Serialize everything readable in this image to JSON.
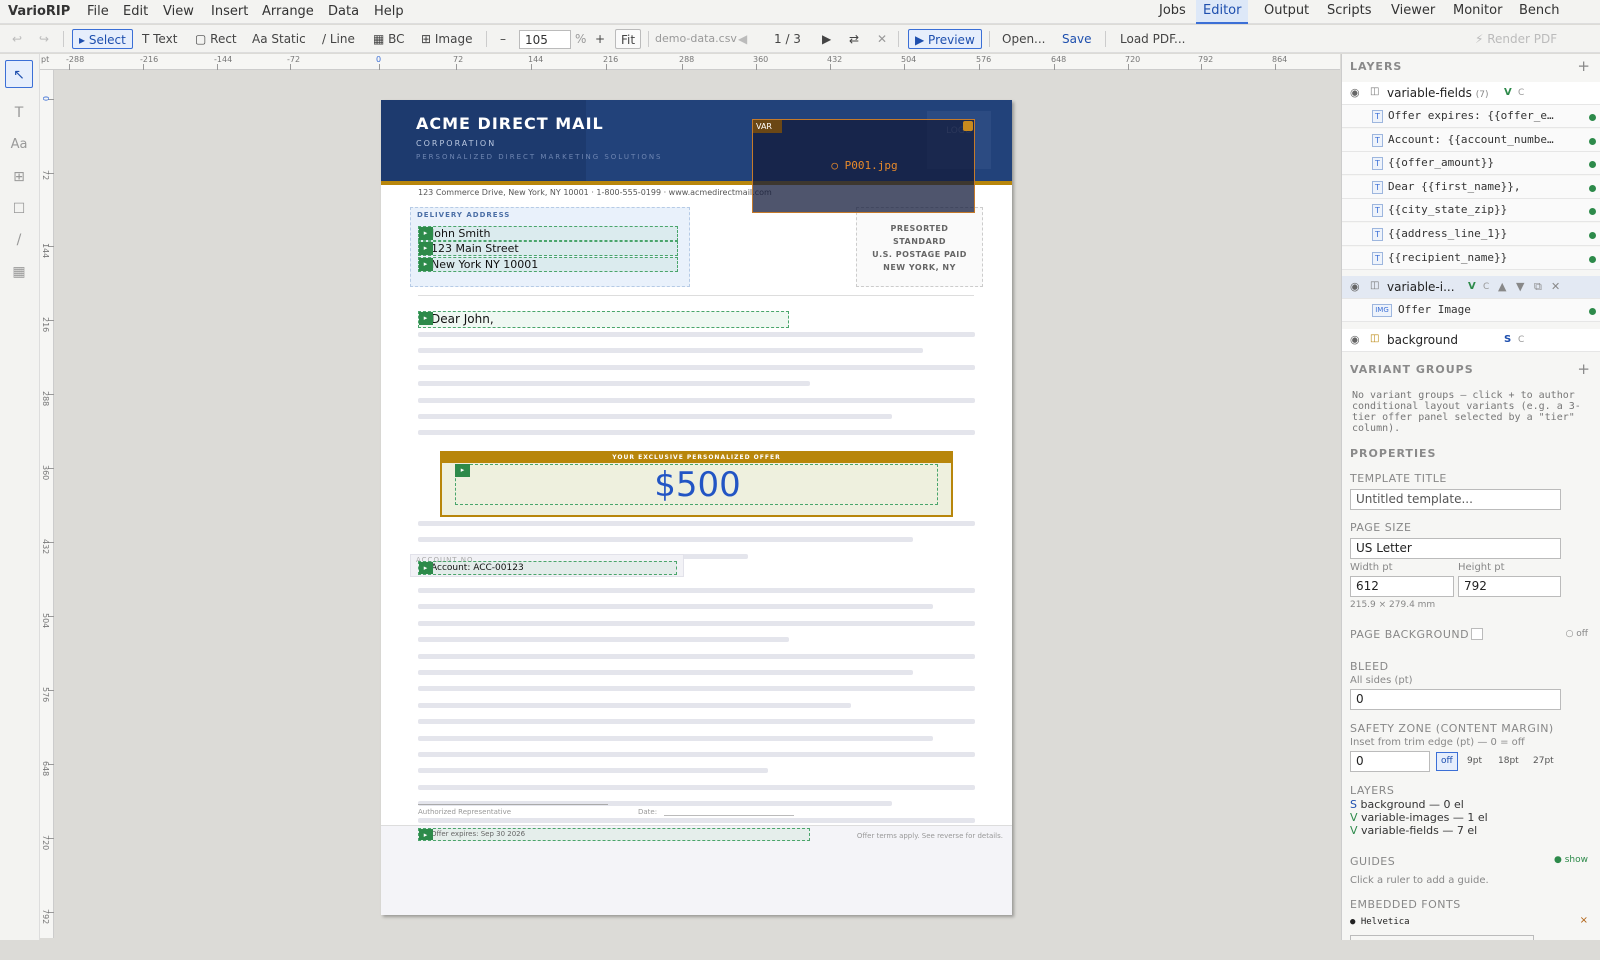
{
  "app": {
    "name": "VarioRIP",
    "menu": [
      "File",
      "Edit",
      "View",
      "Insert",
      "Arrange",
      "Data",
      "Help"
    ],
    "tabs": [
      "Jobs",
      "Editor",
      "Output",
      "Scripts",
      "Viewer",
      "Monitor",
      "Bench"
    ],
    "active_tab": "Editor"
  },
  "toolbar": {
    "undo": "↩",
    "redo": "↪",
    "select": "▸ Select",
    "text": "T Text",
    "rect": "▢ Rect",
    "static": "Aa Static",
    "line": "/ Line",
    "bc": "▦ BC",
    "image": "⊞ Image",
    "zoom_minus": "–",
    "zoom_value": "105",
    "zoom_unit": "%",
    "zoom_plus": "+",
    "fit": "Fit",
    "data_file": "demo-data.csv",
    "prev": "◀",
    "record": "1 / 3",
    "next": "▶",
    "shuffle": "⇄",
    "close": "✕",
    "preview": "▶ Preview",
    "open": "Open...",
    "save": "Save",
    "load_pdf": "Load PDF...",
    "render_pdf": "⚡ Render PDF"
  },
  "ruler": {
    "unit": "pt",
    "h_labels": [
      "-288",
      "-216",
      "-144",
      "-72",
      "0",
      "72",
      "144",
      "216",
      "288",
      "360",
      "432",
      "504",
      "576",
      "648",
      "720",
      "792",
      "864"
    ],
    "v_labels": [
      "0",
      "72",
      "144",
      "216",
      "288",
      "360",
      "432",
      "504",
      "576",
      "648",
      "720",
      "792"
    ]
  },
  "tools": [
    "↖",
    "T",
    "Aa",
    "⊞",
    "☐",
    "/",
    "▦"
  ],
  "document": {
    "company": "ACME DIRECT MAIL",
    "corporation": "CORPORATION",
    "tagline": "PERSONALIZED DIRECT MARKETING SOLUTIONS",
    "logo": "LOGO",
    "contact": "123 Commerce Drive, New York, NY 10001  ·  1-800-555-0199  ·  www.acmedirectmail.com",
    "delivery_label": "DELIVERY ADDRESS",
    "recipient": "John Smith",
    "address": "123 Main Street",
    "city": "New York NY 10001",
    "presort": [
      "PRESORTED",
      "STANDARD",
      "U.S. POSTAGE PAID",
      "NEW YORK, NY"
    ],
    "greeting": "Dear John,",
    "offer_banner": "YOUR EXCLUSIVE PERSONALIZED OFFER",
    "offer_amount": "$500",
    "account_label": "ACCOUNT NO.",
    "account": "Account: ACC-00123",
    "authorized": "Authorized Representative",
    "date_label": "Date:",
    "expires": "Offer expires: Sep 30 2026",
    "terms": "Offer terms apply. See reverse for details.",
    "var_tag": "VAR",
    "var_file": "○ P001.jpg",
    "field_marker": "▸"
  },
  "panel": {
    "layers_title": "LAYERS",
    "plus": "+",
    "layers": [
      {
        "name": "variable-fields",
        "count": "(7)",
        "flag": "V",
        "c": "C"
      },
      {
        "name": "variable-i...",
        "flag": "V",
        "c": "C"
      },
      {
        "name": "background",
        "flag": "S",
        "c": "C"
      }
    ],
    "fields": [
      "Offer expires: {{offer_e…",
      "Account: {{account_numbe…",
      "{{offer_amount}}",
      "Dear {{first_name}},",
      "{{city_state_zip}}",
      "{{address_line_1}}",
      "{{recipient_name}}"
    ],
    "img_type": "IMG",
    "text_type": "T",
    "image_el": "Offer Image",
    "eye": "◉",
    "lock": "◫",
    "ctrl": [
      "▲",
      "▼",
      "⧉",
      "✕"
    ],
    "variant_title": "VARIANT GROUPS",
    "variant_note": "No variant groups — click + to author conditional layout variants (e.g. a 3-tier offer panel selected by a \"tier\" column).",
    "properties_title": "PROPERTIES",
    "template_title_label": "TEMPLATE TITLE",
    "template_title_placeholder": "Untitled template...",
    "page_size_label": "PAGE SIZE",
    "page_size": "US Letter",
    "width_label": "Width pt",
    "height_label": "Height pt",
    "width": "612",
    "height": "792",
    "mm": "215.9 × 279.4 mm",
    "page_bg_label": "PAGE BACKGROUND",
    "page_bg_off": "○ off",
    "bleed_label": "BLEED",
    "bleed_sub": "All sides (pt)",
    "bleed": "0",
    "safety_label": "SAFETY ZONE (CONTENT MARGIN)",
    "safety_sub": "Inset from trim edge (pt) — 0 = off",
    "safety": "0",
    "safety_opts": [
      "off",
      "9pt",
      "18pt",
      "27pt"
    ],
    "layers2_label": "LAYERS",
    "layer_summary": [
      {
        "flag": "S",
        "text": "background — 0 el"
      },
      {
        "flag": "V",
        "text": "variable-images — 1 el"
      },
      {
        "flag": "V",
        "text": "variable-fields — 7 el"
      }
    ],
    "guides_label": "GUIDES",
    "guides_show": "● show",
    "guides_hint": "Click a ruler to add a guide.",
    "fonts_label": "EMBEDDED FONTS",
    "font": "● Helvetica",
    "font_remove": "×"
  },
  "colors": {
    "accent": "#3b6fd6",
    "header": "#1d3a6e",
    "gold": "#b8860b",
    "field": "#2d8a4a",
    "offer_text": "#2255c4"
  }
}
